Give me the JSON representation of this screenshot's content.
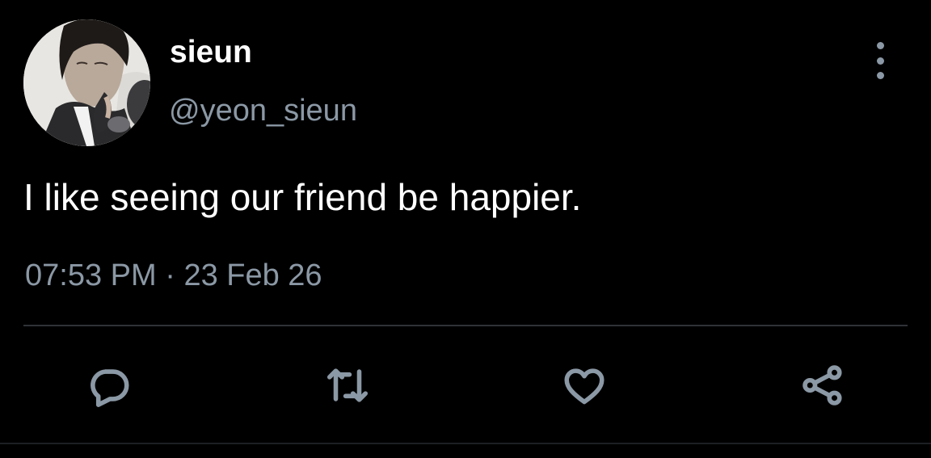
{
  "user": {
    "display_name": "sieun",
    "handle": "@yeon_sieun"
  },
  "tweet": {
    "text": "I like seeing our friend be happier.",
    "time": "07:53 PM",
    "separator": "·",
    "date": "23 Feb 26"
  },
  "actions": {
    "reply_icon": "speech-bubble-icon",
    "retweet_icon": "retweet-arrows-icon",
    "like_icon": "heart-outline-icon",
    "share_icon": "share-nodes-icon"
  },
  "colors": {
    "background": "#000000",
    "primary_text": "#ffffff",
    "secondary_text": "#8b98a5",
    "divider": "#2f3336"
  }
}
